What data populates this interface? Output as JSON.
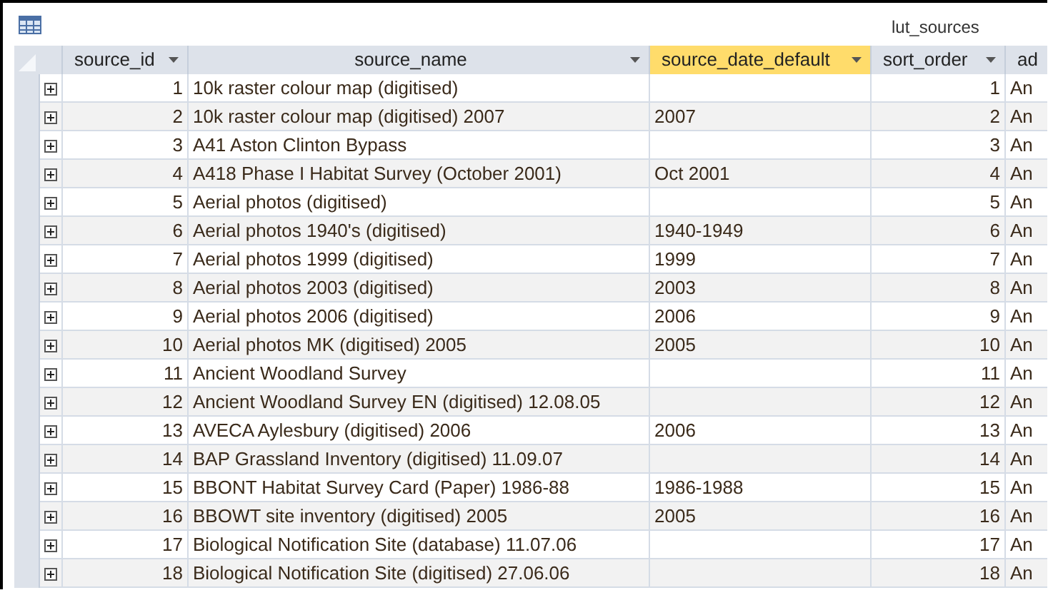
{
  "window": {
    "title": "lut_sources"
  },
  "table": {
    "columns": [
      {
        "label": "source_id",
        "selected": false,
        "sort_menu": true
      },
      {
        "label": "source_name",
        "selected": false,
        "sort_menu": true
      },
      {
        "label": "source_date_default",
        "selected": true,
        "sort_menu": true
      },
      {
        "label": "sort_order",
        "selected": false,
        "sort_menu": true
      },
      {
        "label": "ad",
        "selected": false,
        "sort_menu": false
      }
    ],
    "rows": [
      {
        "cells": [
          "1",
          "10k raster colour map (digitised)",
          "",
          "1",
          "An"
        ]
      },
      {
        "cells": [
          "2",
          "10k raster colour map (digitised) 2007",
          "2007",
          "2",
          "An"
        ]
      },
      {
        "cells": [
          "3",
          "A41 Aston Clinton Bypass",
          "",
          "3",
          "An"
        ]
      },
      {
        "cells": [
          "4",
          "A418 Phase I Habitat Survey (October 2001)",
          "Oct 2001",
          "4",
          "An"
        ]
      },
      {
        "cells": [
          "5",
          "Aerial photos (digitised)",
          "",
          "5",
          "An"
        ]
      },
      {
        "cells": [
          "6",
          "Aerial photos 1940's (digitised)",
          "1940-1949",
          "6",
          "An"
        ]
      },
      {
        "cells": [
          "7",
          "Aerial photos 1999 (digitised)",
          "1999",
          "7",
          "An"
        ]
      },
      {
        "cells": [
          "8",
          "Aerial photos 2003 (digitised)",
          "2003",
          "8",
          "An"
        ]
      },
      {
        "cells": [
          "9",
          "Aerial photos 2006 (digitised)",
          "2006",
          "9",
          "An"
        ]
      },
      {
        "cells": [
          "10",
          "Aerial photos MK (digitised) 2005",
          "2005",
          "10",
          "An"
        ]
      },
      {
        "cells": [
          "11",
          "Ancient Woodland Survey",
          "",
          "11",
          "An"
        ]
      },
      {
        "cells": [
          "12",
          "Ancient Woodland Survey EN (digitised) 12.08.05",
          "",
          "12",
          "An"
        ]
      },
      {
        "cells": [
          "13",
          "AVECA Aylesbury (digitised) 2006",
          "2006",
          "13",
          "An"
        ]
      },
      {
        "cells": [
          "14",
          "BAP Grassland Inventory (digitised) 11.09.07",
          "",
          "14",
          "An"
        ]
      },
      {
        "cells": [
          "15",
          "BBONT Habitat Survey Card (Paper) 1986-88",
          "1986-1988",
          "15",
          "An"
        ]
      },
      {
        "cells": [
          "16",
          "BBOWT site inventory (digitised) 2005",
          "2005",
          "16",
          "An"
        ]
      },
      {
        "cells": [
          "17",
          "Biological Notification Site (database) 11.07.06",
          "",
          "17",
          "An"
        ]
      },
      {
        "cells": [
          "18",
          "Biological Notification Site (digitised) 27.06.06",
          "",
          "18",
          "An"
        ]
      }
    ]
  }
}
